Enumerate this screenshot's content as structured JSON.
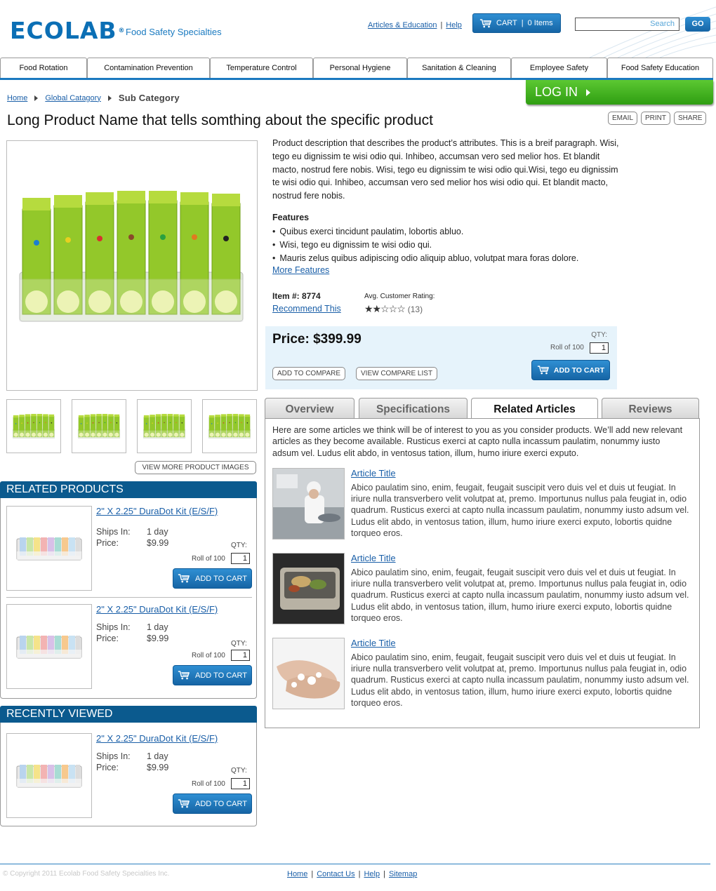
{
  "brand": {
    "logo_text": "ECOLAB",
    "tagline": "Food Safety Specialties",
    "primary_color": "#0b6fb5",
    "accent_green": "#3cae1a"
  },
  "header": {
    "links": [
      "Articles & Education",
      "Help"
    ],
    "cart_label": "CART",
    "cart_count": "0 Items",
    "search_placeholder": "Search",
    "go_label": "GO"
  },
  "nav": {
    "items": [
      "Food Rotation",
      "Contamination Prevention",
      "Temperature Control",
      "Personal Hygiene",
      "Sanitation & Cleaning",
      "Employee Safety",
      "Food Safety Education"
    ]
  },
  "breadcrumb": {
    "items": [
      "Home",
      "Global Catagory"
    ],
    "current": "Sub Category"
  },
  "login_label": "LOG IN",
  "product": {
    "title": "Long Product Name that tells somthing about the specific product",
    "actions": [
      "EMAIL",
      "PRINT",
      "SHARE"
    ],
    "description": "Product description that describes the product’s attributes. This is a breif paragraph. Wisi, tego eu dignissim te wisi odio qui. Inhibeo, accumsan vero sed melior hos. Et blandit macto, nostrud fere nobis. Wisi, tego eu dignissim te wisi odio qui.Wisi, tego eu dignissim te wisi odio qui. Inhibeo, accumsan vero sed melior hos wisi odio qui. Et blandit macto, nostrud fere nobis.",
    "features_title": "Features",
    "features": [
      "Quibus exerci tincidunt paulatim, lobortis abluo.",
      "Wisi, tego eu dignissim te wisi odio qui.",
      "Mauris zelus quibus adipiscing odio aliquip abluo, volutpat mara foras dolore."
    ],
    "more_features": "More Features",
    "item_number": "Item #: 8774",
    "recommend": "Recommend This",
    "rating_label": "Avg. Customer Rating:",
    "rating_stars": 2,
    "rating_max": 5,
    "rating_count": "(13)",
    "price": "Price: $399.99",
    "qty_label": "QTY:",
    "roll_label": "Roll of 100",
    "qty_value": "1",
    "compare": [
      "ADD TO COMPARE",
      "VIEW COMPARE LIST"
    ],
    "add_to_cart": "ADD TO CART",
    "more_images": "VIEW MORE PRODUCT IMAGES"
  },
  "tabs": {
    "items": [
      "Overview",
      "Specifications",
      "Related Articles",
      "Reviews"
    ],
    "active": 2,
    "intro": "Here are some articles we think will be of interest to you as you consider products. We’ll add new relevant articles as they become available. Rusticus exerci at capto nulla incassum paulatim, nonummy iusto adsum vel. Ludus elit abdo, in ventosus tation, illum, humo iriure exerci exputo.",
    "articles": [
      {
        "title": "Article Title",
        "body": "Abico paulatim sino, enim, feugait, feugait suscipit vero duis vel et duis ut feugiat. In iriure nulla transverbero velit volutpat at, premo. Importunus nullus pala feugiat in, odio quadrum. Rusticus exerci at capto nulla incassum paulatim, nonummy iusto adsum vel. Ludus elit abdo, in ventosus tation, illum, humo iriure exerci exputo, lobortis quidne torqueo eros."
      },
      {
        "title": "Article Title",
        "body": "Abico paulatim sino, enim, feugait, feugait suscipit vero duis vel et duis ut feugiat. In iriure nulla transverbero velit volutpat at, premo. Importunus nullus pala feugiat in, odio quadrum. Rusticus exerci at capto nulla incassum paulatim, nonummy iusto adsum vel. Ludus elit abdo, in ventosus tation, illum, humo iriure exerci exputo, lobortis quidne torqueo eros."
      },
      {
        "title": "Article Title",
        "body": "Abico paulatim sino, enim, feugait, feugait suscipit vero duis vel et duis ut feugiat. In iriure nulla transverbero velit volutpat at, premo. Importunus nullus pala feugiat in, odio quadrum. Rusticus exerci at capto nulla incassum paulatim, nonummy iusto adsum vel. Ludus elit abdo, in ventosus tation, illum, humo iriure exerci exputo, lobortis quidne torqueo eros."
      }
    ]
  },
  "related_products": {
    "heading": "RELATED PRODUCTS",
    "items": [
      {
        "name": "2\" X 2.25\" DuraDot Kit (E/S/F) ",
        "ships_label": "Ships In:",
        "ships_value": "1 day",
        "price_label": "Price:",
        "price_value": "$9.99",
        "qty_label": "QTY:",
        "roll_label": "Roll of 100",
        "qty_value": "1",
        "cart_label": "ADD TO CART"
      },
      {
        "name": "2\" X 2.25\" DuraDot Kit (E/S/F) ",
        "ships_label": "Ships In:",
        "ships_value": "1 day",
        "price_label": "Price:",
        "price_value": "$9.99",
        "qty_label": "QTY:",
        "roll_label": "Roll of 100",
        "qty_value": "1",
        "cart_label": "ADD TO CART"
      }
    ]
  },
  "recently_viewed": {
    "heading": "RECENTLY VIEWED",
    "items": [
      {
        "name": "2\" X 2.25\" DuraDot Kit (E/S/F) ",
        "ships_label": "Ships In:",
        "ships_value": "1 day",
        "price_label": "Price:",
        "price_value": "$9.99",
        "qty_label": "QTY:",
        "roll_label": "Roll of 100",
        "qty_value": "1",
        "cart_label": "ADD TO CART"
      }
    ]
  },
  "footer": {
    "copyright": "© Copyright 2011 Ecolab Food Safety Specialties Inc.",
    "links": [
      "Home",
      "Contact Us",
      "Help",
      "Sitemap"
    ]
  }
}
